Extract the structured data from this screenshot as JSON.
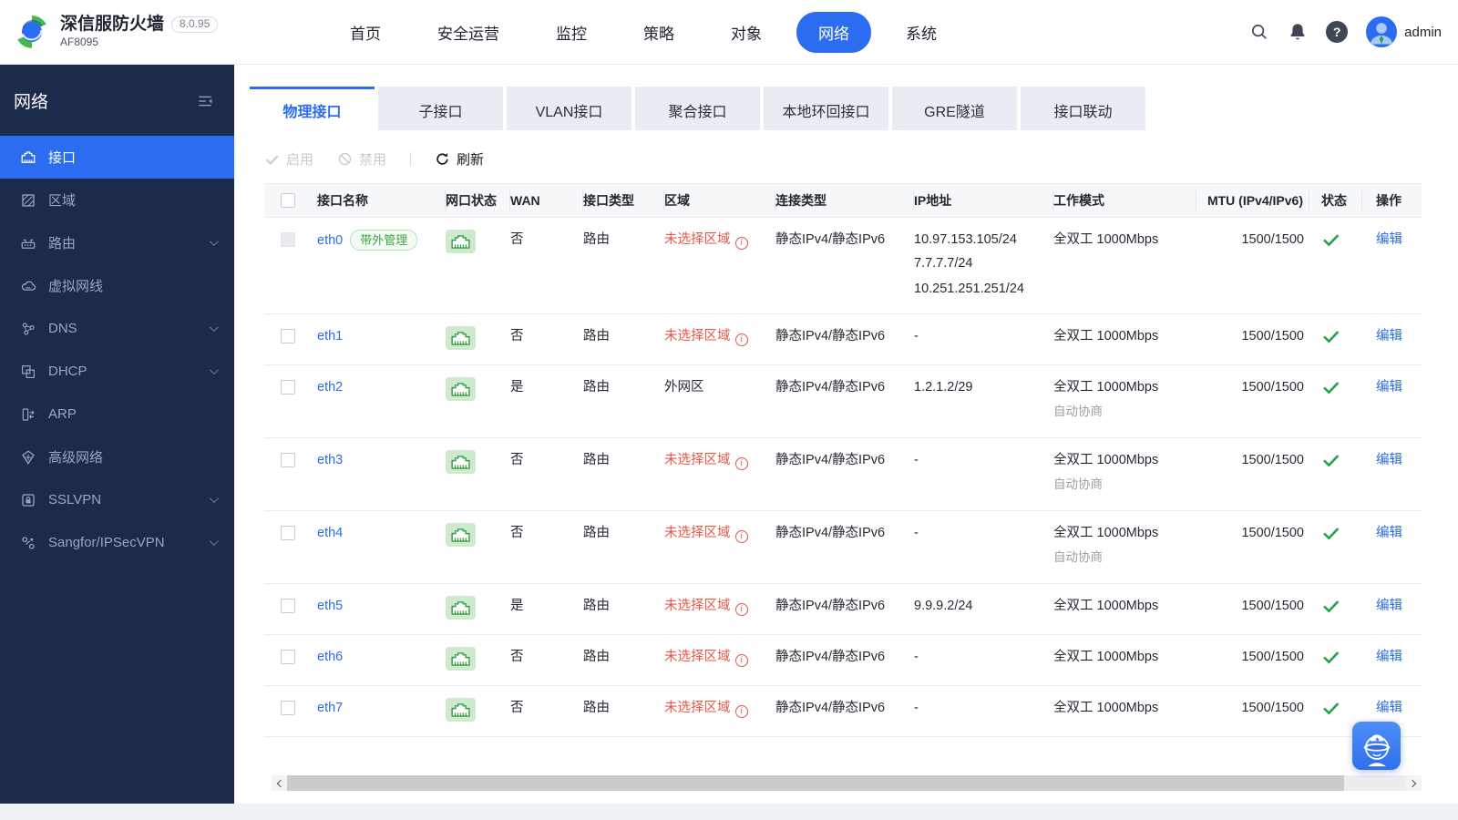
{
  "topbar": {
    "brand": {
      "title": "深信服防火墙",
      "version": "8.0.95",
      "model": "AF8095"
    },
    "nav": [
      {
        "key": "home",
        "label": "首页",
        "active": false
      },
      {
        "key": "security-ops",
        "label": "安全运营",
        "active": false
      },
      {
        "key": "monitor",
        "label": "监控",
        "active": false
      },
      {
        "key": "policy",
        "label": "策略",
        "active": false
      },
      {
        "key": "object",
        "label": "对象",
        "active": false
      },
      {
        "key": "network",
        "label": "网络",
        "active": true
      },
      {
        "key": "system",
        "label": "系统",
        "active": false
      }
    ],
    "help_glyph": "?",
    "user": "admin"
  },
  "sidebar": {
    "title": "网络",
    "items": [
      {
        "key": "interface",
        "label": "接口",
        "icon": "interface-port",
        "active": true,
        "expandable": false
      },
      {
        "key": "zone",
        "label": "区域",
        "icon": "zone",
        "active": false,
        "expandable": false
      },
      {
        "key": "route",
        "label": "路由",
        "icon": "router",
        "active": false,
        "expandable": true
      },
      {
        "key": "virtual-wire",
        "label": "虚拟网线",
        "icon": "virtual-wire",
        "active": false,
        "expandable": false
      },
      {
        "key": "dns",
        "label": "DNS",
        "icon": "dns",
        "active": false,
        "expandable": true
      },
      {
        "key": "dhcp",
        "label": "DHCP",
        "icon": "dhcp",
        "active": false,
        "expandable": true
      },
      {
        "key": "arp",
        "label": "ARP",
        "icon": "arp",
        "active": false,
        "expandable": false
      },
      {
        "key": "advanced-network",
        "label": "高级网络",
        "icon": "advanced-network",
        "active": false,
        "expandable": false
      },
      {
        "key": "sslvpn",
        "label": "SSLVPN",
        "icon": "sslvpn-lock",
        "active": false,
        "expandable": true
      },
      {
        "key": "ipsecvpn",
        "label": "Sangfor/IPSecVPN",
        "icon": "ipsecvpn",
        "active": false,
        "expandable": true
      }
    ]
  },
  "tabs": [
    {
      "key": "physical",
      "label": "物理接口",
      "active": true
    },
    {
      "key": "subinterface",
      "label": "子接口",
      "active": false
    },
    {
      "key": "vlan",
      "label": "VLAN接口",
      "active": false
    },
    {
      "key": "aggregate",
      "label": "聚合接口",
      "active": false
    },
    {
      "key": "loopback",
      "label": "本地环回接口",
      "active": false
    },
    {
      "key": "gre",
      "label": "GRE隧道",
      "active": false
    },
    {
      "key": "linkage",
      "label": "接口联动",
      "active": false
    }
  ],
  "toolbar": {
    "buttons": [
      {
        "key": "enable",
        "label": "启用",
        "icon": "check",
        "disabled": true
      },
      {
        "key": "disable",
        "label": "禁用",
        "icon": "ban",
        "disabled": true
      },
      {
        "key": "refresh",
        "label": "刷新",
        "icon": "refresh",
        "disabled": false
      }
    ]
  },
  "table": {
    "info_glyph": "i",
    "columns": [
      "",
      "接口名称",
      "网口状态",
      "WAN",
      "接口类型",
      "区域",
      "连接类型",
      "IP地址",
      "工作模式",
      "MTU (IPv4/IPv6)",
      "状态",
      "操作"
    ],
    "rows": [
      {
        "name": "eth0",
        "badge": "带外管理",
        "checkbox_disabled": true,
        "wan": "否",
        "type": "路由",
        "zone": "未选择区域",
        "zone_warn": true,
        "conn": "静态IPv4/静态IPv6",
        "ips": [
          "10.97.153.105/24",
          "7.7.7.7/24",
          "10.251.251.251/24"
        ],
        "mode": "全双工 1000Mbps",
        "mode_sub": "",
        "mtu": "1500/1500",
        "status": "ok",
        "action": "编辑"
      },
      {
        "name": "eth1",
        "badge": "",
        "checkbox_disabled": false,
        "wan": "否",
        "type": "路由",
        "zone": "未选择区域",
        "zone_warn": true,
        "conn": "静态IPv4/静态IPv6",
        "ips": [
          "-"
        ],
        "mode": "全双工 1000Mbps",
        "mode_sub": "",
        "mtu": "1500/1500",
        "status": "ok",
        "action": "编辑"
      },
      {
        "name": "eth2",
        "badge": "",
        "checkbox_disabled": false,
        "wan": "是",
        "type": "路由",
        "zone": "外网区",
        "zone_warn": false,
        "conn": "静态IPv4/静态IPv6",
        "ips": [
          "1.2.1.2/29"
        ],
        "mode": "全双工 1000Mbps",
        "mode_sub": "自动协商",
        "mtu": "1500/1500",
        "status": "ok",
        "action": "编辑"
      },
      {
        "name": "eth3",
        "badge": "",
        "checkbox_disabled": false,
        "wan": "否",
        "type": "路由",
        "zone": "未选择区域",
        "zone_warn": true,
        "conn": "静态IPv4/静态IPv6",
        "ips": [
          "-"
        ],
        "mode": "全双工 1000Mbps",
        "mode_sub": "自动协商",
        "mtu": "1500/1500",
        "status": "ok",
        "action": "编辑"
      },
      {
        "name": "eth4",
        "badge": "",
        "checkbox_disabled": false,
        "wan": "否",
        "type": "路由",
        "zone": "未选择区域",
        "zone_warn": true,
        "conn": "静态IPv4/静态IPv6",
        "ips": [
          "-"
        ],
        "mode": "全双工 1000Mbps",
        "mode_sub": "自动协商",
        "mtu": "1500/1500",
        "status": "ok",
        "action": "编辑"
      },
      {
        "name": "eth5",
        "badge": "",
        "checkbox_disabled": false,
        "wan": "是",
        "type": "路由",
        "zone": "未选择区域",
        "zone_warn": true,
        "conn": "静态IPv4/静态IPv6",
        "ips": [
          "9.9.9.2/24"
        ],
        "mode": "全双工 1000Mbps",
        "mode_sub": "",
        "mtu": "1500/1500",
        "status": "ok",
        "action": "编辑"
      },
      {
        "name": "eth6",
        "badge": "",
        "checkbox_disabled": false,
        "wan": "否",
        "type": "路由",
        "zone": "未选择区域",
        "zone_warn": true,
        "conn": "静态IPv4/静态IPv6",
        "ips": [
          "-"
        ],
        "mode": "全双工 1000Mbps",
        "mode_sub": "",
        "mtu": "1500/1500",
        "status": "ok",
        "action": "编辑"
      },
      {
        "name": "eth7",
        "badge": "",
        "checkbox_disabled": false,
        "wan": "否",
        "type": "路由",
        "zone": "未选择区域",
        "zone_warn": true,
        "conn": "静态IPv4/静态IPv6",
        "ips": [
          "-"
        ],
        "mode": "全双工 1000Mbps",
        "mode_sub": "",
        "mtu": "1500/1500",
        "status": "ok",
        "action": "编辑"
      }
    ]
  }
}
